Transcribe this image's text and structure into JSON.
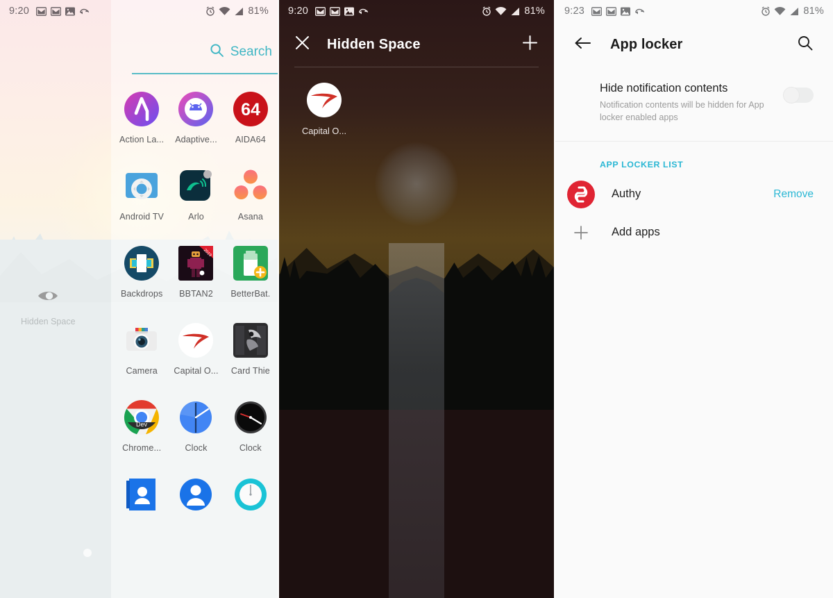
{
  "screens": [
    {
      "id": "app-drawer",
      "status_bar": {
        "time": "9:20",
        "battery": "81%",
        "icons": [
          "gmail-icon",
          "gmail-icon",
          "photo-icon",
          "sync-icon",
          "alarm-icon",
          "wifi-icon",
          "signal-icon"
        ]
      },
      "search": {
        "label": "Search",
        "icon": "search-icon"
      },
      "hidden_space": {
        "label": "Hidden Space",
        "icon": "eye-icon"
      },
      "apps": [
        {
          "label": "Action La...",
          "icon": "action-launcher-icon"
        },
        {
          "label": "Adaptive...",
          "icon": "adaptive-icons-icon"
        },
        {
          "label": "AIDA64",
          "icon": "aida64-icon"
        },
        {
          "label": "Android TV",
          "icon": "android-tv-icon"
        },
        {
          "label": "Arlo",
          "icon": "arlo-icon"
        },
        {
          "label": "Asana",
          "icon": "asana-icon"
        },
        {
          "label": "Backdrops",
          "icon": "backdrops-icon"
        },
        {
          "label": "BBTAN2",
          "icon": "bbtan2-icon"
        },
        {
          "label": "BetterBat.",
          "icon": "betterbatterystats-icon"
        },
        {
          "label": "Camera",
          "icon": "camera-icon"
        },
        {
          "label": "Capital O...",
          "icon": "capital-one-icon"
        },
        {
          "label": "Card Thie",
          "icon": "card-thief-icon"
        },
        {
          "label": "Chrome...",
          "icon": "chrome-dev-icon"
        },
        {
          "label": "Clock",
          "icon": "google-clock-icon"
        },
        {
          "label": "Clock",
          "icon": "oneplus-clock-icon"
        },
        {
          "label": "",
          "icon": "contacts-icon"
        },
        {
          "label": "",
          "icon": "google-contacts-icon"
        },
        {
          "label": "",
          "icon": "timer-icon"
        }
      ]
    },
    {
      "id": "hidden-space",
      "status_bar": {
        "time": "9:20",
        "battery": "81%",
        "icons": [
          "gmail-icon",
          "gmail-icon",
          "photo-icon",
          "sync-icon",
          "alarm-icon",
          "wifi-icon",
          "signal-icon"
        ]
      },
      "topbar": {
        "close_icon": "close-icon",
        "title": "Hidden Space",
        "add_icon": "plus-icon"
      },
      "apps": [
        {
          "label": "Capital O...",
          "icon": "capital-one-icon"
        }
      ]
    },
    {
      "id": "app-locker",
      "status_bar": {
        "time": "9:23",
        "battery": "81%",
        "icons": [
          "gmail-icon",
          "gmail-icon",
          "photo-icon",
          "sync-icon",
          "alarm-icon",
          "wifi-icon",
          "signal-icon"
        ]
      },
      "topbar": {
        "back_icon": "back-arrow-icon",
        "title": "App locker",
        "search_icon": "search-icon"
      },
      "preference": {
        "title": "Hide notification contents",
        "subtitle": "Notification contents will be hidden for App locker enabled apps",
        "toggle_state": "off"
      },
      "section_header": "APP LOCKER LIST",
      "locked_apps": [
        {
          "name": "Authy",
          "icon": "authy-icon",
          "action": "Remove"
        }
      ],
      "add_apps": {
        "label": "Add apps",
        "icon": "plus-icon"
      }
    }
  ],
  "colors": {
    "accent_teal": "#3fb6c4",
    "accent_cyan": "#2ab7d4",
    "dark_bg": "#1d1010",
    "light_bg": "#fafafa"
  }
}
